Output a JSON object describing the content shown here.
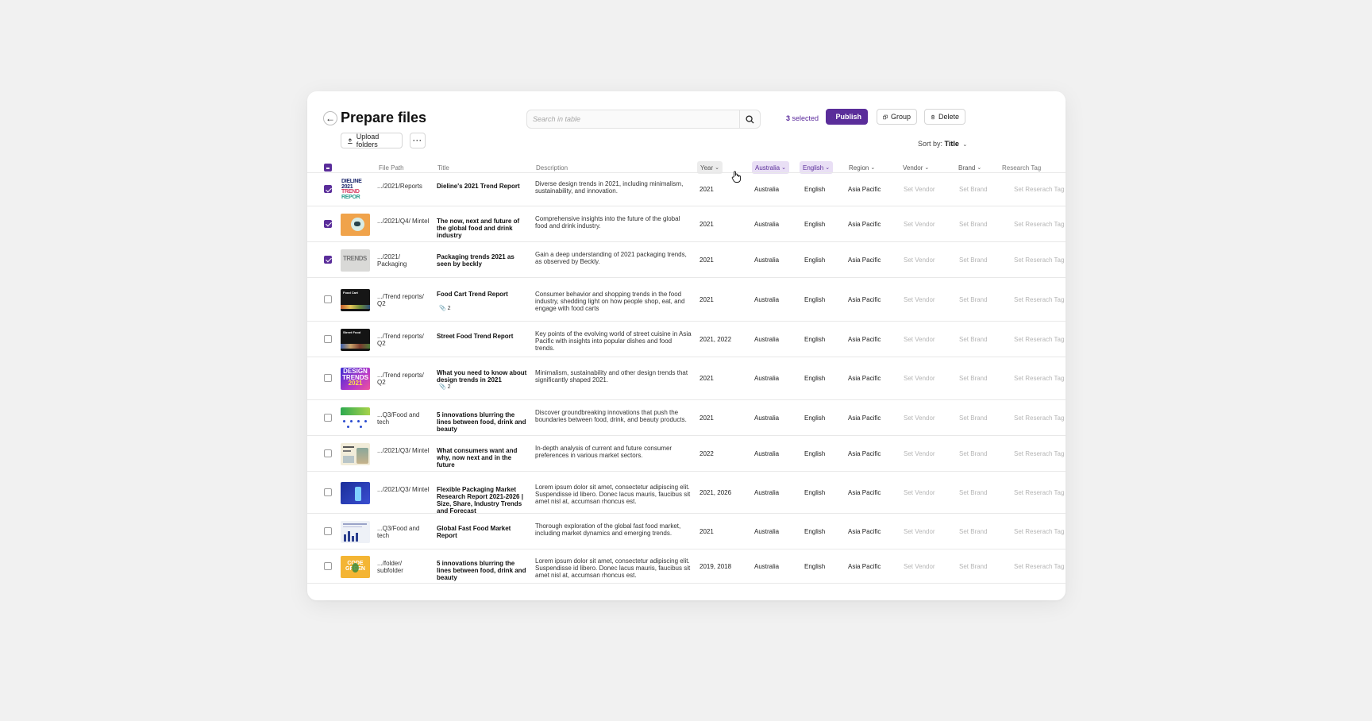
{
  "page_title": "Prepare files",
  "search": {
    "placeholder": "Search in table"
  },
  "toolbar": {
    "selected_num": "3",
    "selected_label": "selected",
    "publish_label": "Publish",
    "group_label": "Group",
    "delete_label": "Delete",
    "upload_label": "Upload folders",
    "more_label": "···"
  },
  "sort": {
    "label": "Sort by:",
    "value": "Title"
  },
  "columns": {
    "file_path": "File Path",
    "title": "Title",
    "description": "Description",
    "year": "Year",
    "country": "Australia",
    "language": "English",
    "region": "Region",
    "vendor": "Vendor",
    "brand": "Brand",
    "research_tag": "Research Tag"
  },
  "colors": {
    "accent": "#5a2d9a",
    "filter_bg": "#e9dff5"
  },
  "rows": [
    {
      "checked": true,
      "thumb": "dieline",
      "path": ".../2021/Reports",
      "title": "Dieline's 2021 Trend Report",
      "attach": "",
      "desc": "Diverse design trends in 2021, including minimalism, sustainability, and innovation.",
      "year": "2021",
      "country": "Australia",
      "lang": "English",
      "region": "Asia Pacific",
      "vendor": "Set Vendor",
      "brand": "Set Brand",
      "tag": "Set Reserach Tag"
    },
    {
      "checked": true,
      "thumb": "food-orange",
      "path": ".../2021/Q4/ Mintel",
      "title": "The now, next and future of the global food and drink industry",
      "attach": "",
      "desc": "Comprehensive insights into the future of the global food and drink industry.",
      "year": "2021",
      "country": "Australia",
      "lang": "English",
      "region": "Asia Pacific",
      "vendor": "Set Vendor",
      "brand": "Set Brand",
      "tag": "Set Reserach Tag"
    },
    {
      "checked": true,
      "thumb": "trends-gray",
      "path": ".../2021/ Packaging",
      "title": "Packaging trends 2021 as seen by beckly",
      "attach": "",
      "desc": "Gain a deep understanding of 2021 packaging trends, as observed by Beckly.",
      "year": "2021",
      "country": "Australia",
      "lang": "English",
      "region": "Asia Pacific",
      "vendor": "Set Vendor",
      "brand": "Set Brand",
      "tag": "Set Reserach Tag"
    },
    {
      "checked": false,
      "thumb": "dark-food",
      "path": ".../Trend reports/ Q2",
      "title": "Food Cart Trend Report",
      "attach": "2",
      "desc": "Consumer behavior and shopping trends in the food industry, shedding light on how people shop, eat, and engage with food carts",
      "year": "2021",
      "country": "Australia",
      "lang": "English",
      "region": "Asia Pacific",
      "vendor": "Set Vendor",
      "brand": "Set Brand",
      "tag": "Set Reserach Tag"
    },
    {
      "checked": false,
      "thumb": "dark-street",
      "path": ".../Trend reports/ Q2",
      "title": "Street Food Trend Report",
      "attach": "",
      "desc": "Key points of the evolving world of street cuisine in Asia Pacific with insights into popular dishes and food trends.",
      "year": "2021, 2022",
      "country": "Australia",
      "lang": "English",
      "region": "Asia Pacific",
      "vendor": "Set Vendor",
      "brand": "Set Brand",
      "tag": "Set Reserach Tag"
    },
    {
      "checked": false,
      "thumb": "design-trends",
      "path": ".../Trend reports/ Q2",
      "title": "What you need to know about design trends in 2021",
      "attach": "2",
      "desc": "Minimalism, sustainability and other design trends that significantly shaped 2021.",
      "year": "2021",
      "country": "Australia",
      "lang": "English",
      "region": "Asia Pacific",
      "vendor": "Set Vendor",
      "brand": "Set Brand",
      "tag": "Set Reserach Tag"
    },
    {
      "checked": false,
      "thumb": "green-tech",
      "path": "...Q3/Food and tech",
      "title": "5 innovations blurring the lines between food, drink and beauty",
      "attach": "",
      "desc": "Discover groundbreaking innovations that push the boundaries between food, drink, and beauty products.",
      "year": "2021",
      "country": "Australia",
      "lang": "English",
      "region": "Asia Pacific",
      "vendor": "Set Vendor",
      "brand": "Set Brand",
      "tag": "Set Reserach Tag"
    },
    {
      "checked": false,
      "thumb": "consumers",
      "path": ".../2021/Q3/ Mintel",
      "title": "What consumers want and why, now next and in the future",
      "attach": "",
      "desc": "In-depth analysis of current and future consumer preferences in various market sectors.",
      "year": "2022",
      "country": "Australia",
      "lang": "English",
      "region": "Asia Pacific",
      "vendor": "Set Vendor",
      "brand": "Set Brand",
      "tag": "Set Reserach Tag"
    },
    {
      "checked": false,
      "thumb": "blue-pack",
      "path": ".../2021/Q3/ Mintel",
      "title": "Flexible Packaging Market Research Report 2021-2026 | Size, Share, Industry Trends and Forecast",
      "attach": "",
      "desc": "Lorem ipsum dolor sit amet, consectetur adipiscing elit. Suspendisse id libero. Donec lacus mauris, faucibus sit amet nisl at, accumsan rhoncus est.",
      "year": "2021, 2026",
      "country": "Australia",
      "lang": "English",
      "region": "Asia Pacific",
      "vendor": "Set Vendor",
      "brand": "Set Brand",
      "tag": "Set Reserach Tag"
    },
    {
      "checked": false,
      "thumb": "fastfood-doc",
      "path": "...Q3/Food and tech",
      "title": "Global Fast Food Market Report",
      "attach": "",
      "desc": "Thorough exploration of the global fast food market, including market dynamics and emerging trends.",
      "year": "2021",
      "country": "Australia",
      "lang": "English",
      "region": "Asia Pacific",
      "vendor": "Set Vendor",
      "brand": "Set Brand",
      "tag": "Set Reserach Tag"
    },
    {
      "checked": false,
      "thumb": "yellow-green",
      "path": ".../folder/ subfolder",
      "title": "5 innovations blurring the lines between food, drink and beauty",
      "attach": "",
      "desc": "Lorem ipsum dolor sit amet, consectetur adipiscing elit. Suspendisse id libero. Donec lacus mauris, faucibus sit amet nisl at, accumsan rhoncus est.",
      "year": "2019, 2018",
      "country": "Australia",
      "lang": "English",
      "region": "Asia Pacific",
      "vendor": "Set Vendor",
      "brand": "Set Brand",
      "tag": "Set Reserach Tag"
    }
  ]
}
